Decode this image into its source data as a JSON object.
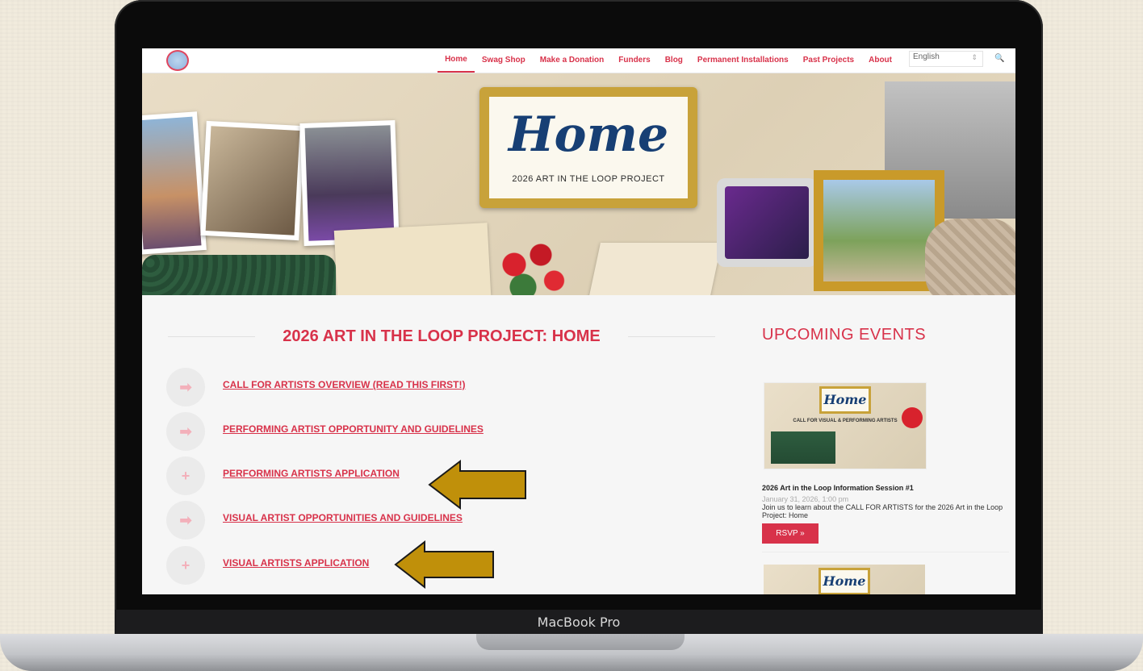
{
  "device": {
    "label": "MacBook Pro"
  },
  "site": {
    "nav": [
      "Home",
      "Swag Shop",
      "Make a Donation",
      "Funders",
      "Blog",
      "Permanent Installations",
      "Past Projects",
      "About"
    ],
    "active_nav": "Home",
    "language": "English"
  },
  "hero": {
    "title": "Home",
    "subtitle": "2026 ART IN THE LOOP PROJECT"
  },
  "main": {
    "heading": "2026 ART IN THE LOOP PROJECT: HOME",
    "links": [
      {
        "label": "CALL FOR ARTISTS OVERVIEW (READ THIS FIRST!)",
        "icon": "arrow-right-icon"
      },
      {
        "label": "PERFORMING ARTIST OPPORTUNITY AND GUIDELINES",
        "icon": "arrow-right-icon"
      },
      {
        "label": "PERFORMING ARTISTS APPLICATION",
        "icon": "plus-icon"
      },
      {
        "label": "VISUAL ARTIST OPPORTUNITIES AND GUIDELINES",
        "icon": "arrow-right-icon"
      },
      {
        "label": "VISUAL ARTISTS APPLICATION",
        "icon": "plus-icon"
      }
    ]
  },
  "sidebar": {
    "title": "UPCOMING EVENTS",
    "event": {
      "card_title": "Home",
      "card_call": "CALL FOR VISUAL & PERFORMING ARTISTS",
      "name": "2026 Art in the Loop Information Session #1",
      "date": "January 31, 2026, 1:00 pm",
      "description": "Join us to learn about the CALL FOR ARTISTS for the 2026 Art in the Loop Project: Home",
      "button": "RSVP »"
    },
    "event2": {
      "card_title": "Home"
    }
  },
  "colors": {
    "accent": "#d8324a",
    "arrow": "#c0900a",
    "sign_blue": "#173f74"
  }
}
